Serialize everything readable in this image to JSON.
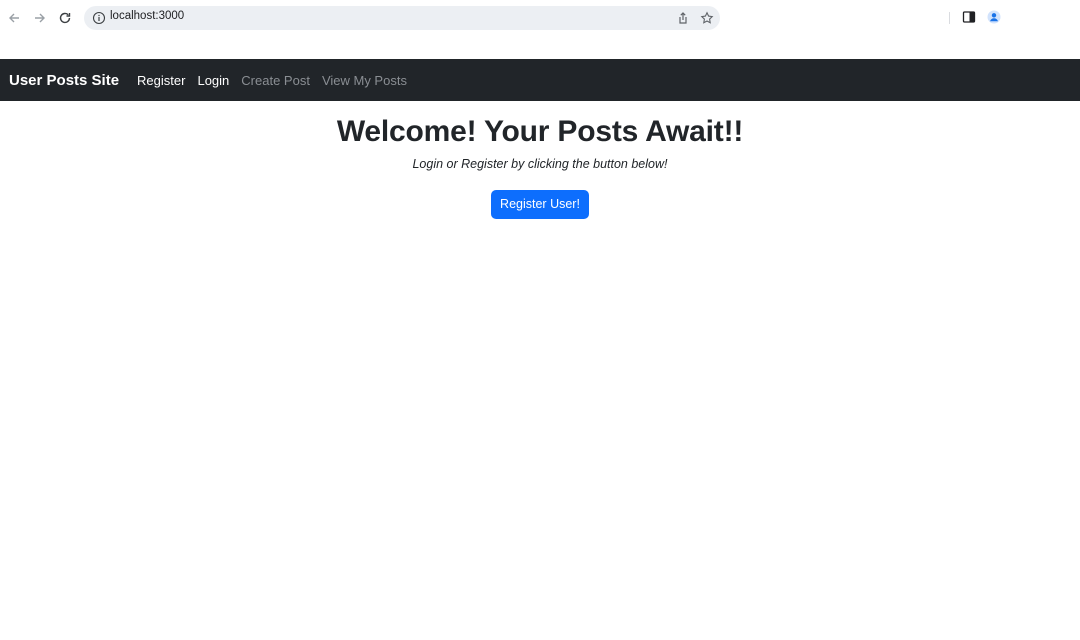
{
  "browser": {
    "url": "localhost:3000",
    "icons": {
      "back": "arrow-left-icon",
      "forward": "arrow-right-icon",
      "reload": "reload-icon",
      "info": "info-icon",
      "share": "share-icon",
      "bookmark": "star-icon",
      "sidebar": "side-panel-icon",
      "profile": "profile-icon"
    }
  },
  "navbar": {
    "brand": "User Posts Site",
    "links": [
      {
        "label": "Register",
        "state": "active"
      },
      {
        "label": "Login",
        "state": "active"
      },
      {
        "label": "Create Post",
        "state": "muted"
      },
      {
        "label": "View My Posts",
        "state": "muted"
      }
    ],
    "background": "#212529"
  },
  "main": {
    "heading": "Welcome! Your Posts Await!!",
    "subtitle": "Login or Register by clicking the button below!",
    "button_label": "Register User!",
    "button_color": "#0d6efd"
  }
}
